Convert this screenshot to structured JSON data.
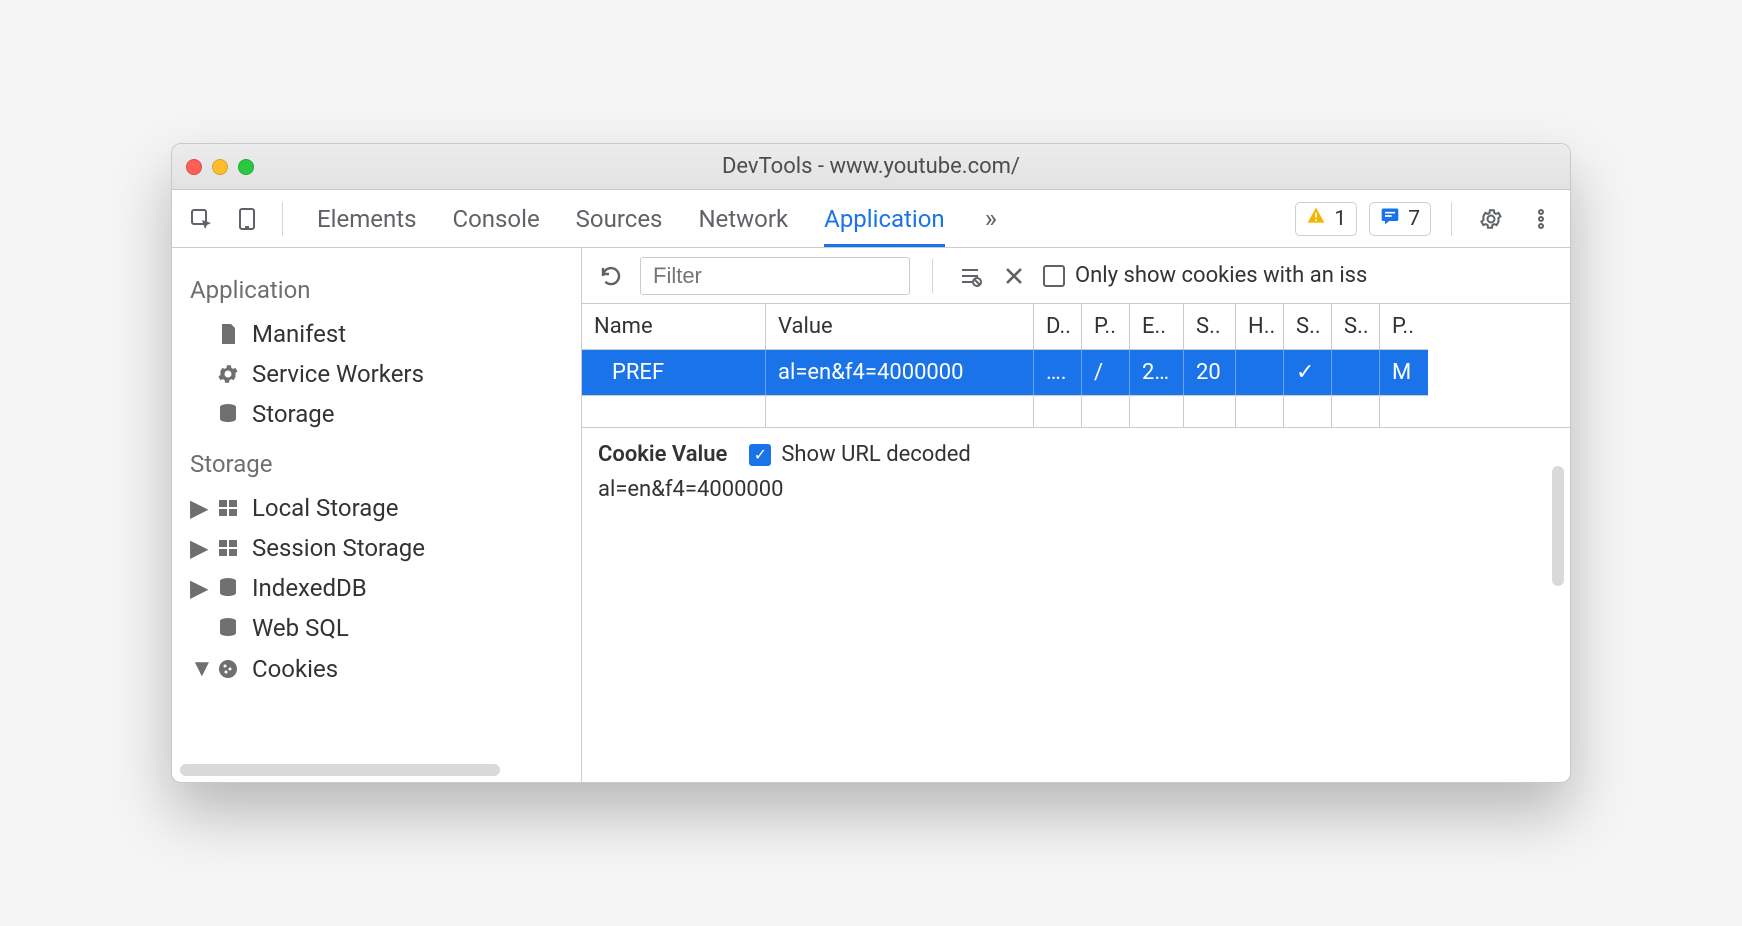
{
  "window": {
    "title": "DevTools - www.youtube.com/"
  },
  "tabs": {
    "items": [
      "Elements",
      "Console",
      "Sources",
      "Network",
      "Application"
    ],
    "active": "Application"
  },
  "warnings": {
    "count": "1"
  },
  "messages": {
    "count": "7"
  },
  "sidebar": {
    "groups": [
      {
        "title": "Application",
        "items": [
          {
            "label": "Manifest",
            "icon": "file-icon",
            "expandable": false
          },
          {
            "label": "Service Workers",
            "icon": "gear-icon",
            "expandable": false
          },
          {
            "label": "Storage",
            "icon": "database-icon",
            "expandable": false
          }
        ]
      },
      {
        "title": "Storage",
        "items": [
          {
            "label": "Local Storage",
            "icon": "grid-icon",
            "expandable": true,
            "expanded": false
          },
          {
            "label": "Session Storage",
            "icon": "grid-icon",
            "expandable": true,
            "expanded": false
          },
          {
            "label": "IndexedDB",
            "icon": "database-icon",
            "expandable": true,
            "expanded": false
          },
          {
            "label": "Web SQL",
            "icon": "database-icon",
            "expandable": false
          },
          {
            "label": "Cookies",
            "icon": "cookie-icon",
            "expandable": true,
            "expanded": true
          }
        ]
      }
    ]
  },
  "toolbar": {
    "filter_placeholder": "Filter",
    "only_issues_label": "Only show cookies with an iss"
  },
  "table": {
    "headers": [
      "Name",
      "Value",
      "D..",
      "P..",
      "E..",
      "S..",
      "H..",
      "S..",
      "S..",
      "P.."
    ],
    "rows": [
      {
        "cells": [
          "PREF",
          "al=en&f4=4000000",
          "….",
          "/",
          "2…",
          "20",
          "",
          "✓",
          "",
          "M"
        ],
        "selected": true
      }
    ]
  },
  "detail": {
    "label": "Cookie Value",
    "decoded_label": "Show URL decoded",
    "decoded_checked": true,
    "value": "al=en&f4=4000000"
  }
}
